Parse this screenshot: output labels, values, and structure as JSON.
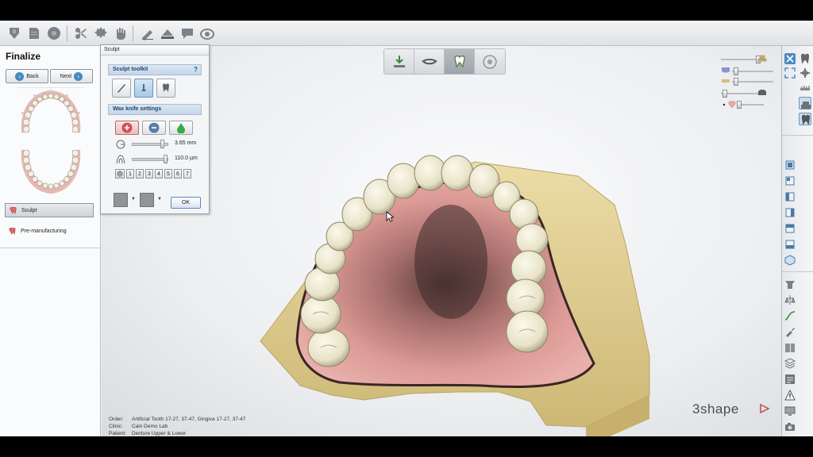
{
  "left_panel": {
    "title": "Finalize",
    "back_label": "Back",
    "next_label": "Next",
    "steps": [
      {
        "label": "Sculpt",
        "active": true
      },
      {
        "label": "Pre-manufacturing",
        "active": false
      }
    ]
  },
  "sculpt_dialog": {
    "title": "Sculpt",
    "toolkit_header": "Sculpt toolkit",
    "help": "?",
    "wax_header": "Wax knife settings",
    "size_value": "3.65 mm",
    "thickness_value": "110.0 µm",
    "levels": [
      "1",
      "2",
      "3",
      "4",
      "5",
      "6",
      "7"
    ],
    "ok_label": "OK"
  },
  "info": {
    "order_label": "Order:",
    "order_value": "Artificial Tooth 17-27, 37-47, Gingiva 17-27, 37-47",
    "clinic_label": "Clinic:",
    "clinic_value": "Cain Demo Lab",
    "patient_label": "Patient:",
    "patient_value": "Denture Upper & Lower"
  },
  "brand": {
    "name": "3shape"
  },
  "colors": {
    "accent": "#3f8ac6",
    "gingiva": "#d9928f",
    "model": "#e6d49a",
    "teeth": "#eeead4"
  }
}
